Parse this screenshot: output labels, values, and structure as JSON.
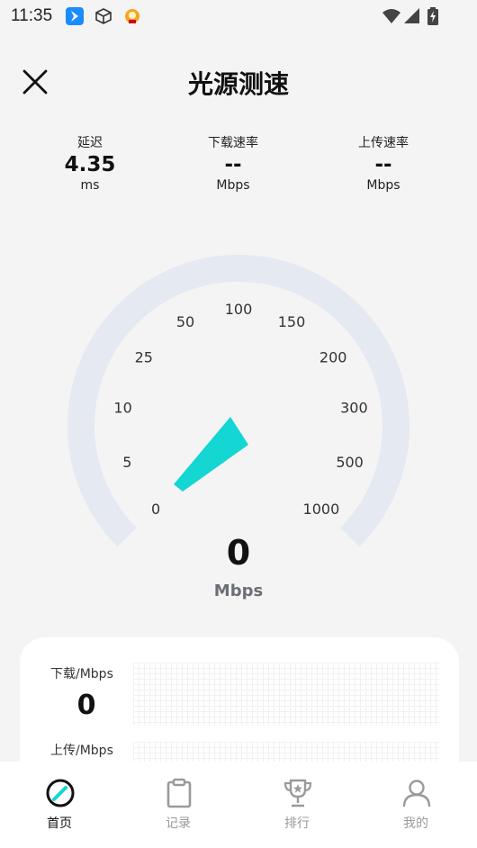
{
  "status_bar": {
    "time": "11:35"
  },
  "header": {
    "title": "光源测速"
  },
  "metrics": [
    {
      "label": "延迟",
      "value": "4.35",
      "unit": "ms"
    },
    {
      "label": "下载速率",
      "value": "--",
      "unit": "Mbps"
    },
    {
      "label": "上传速率",
      "value": "--",
      "unit": "Mbps"
    }
  ],
  "gauge": {
    "ticks": [
      "0",
      "5",
      "10",
      "25",
      "50",
      "100",
      "150",
      "200",
      "300",
      "500",
      "1000"
    ],
    "current_value": "0",
    "unit": "Mbps",
    "accent_color": "#14d6d3",
    "track_color": "#e5e9f2"
  },
  "results_card": {
    "download_label": "下载/Mbps",
    "download_value": "0",
    "upload_label": "上传/Mbps"
  },
  "tabs": [
    {
      "label": "首页",
      "icon": "speedometer-icon",
      "active": true
    },
    {
      "label": "记录",
      "icon": "clipboard-icon",
      "active": false
    },
    {
      "label": "排行",
      "icon": "trophy-icon",
      "active": false
    },
    {
      "label": "我的",
      "icon": "person-icon",
      "active": false
    }
  ]
}
